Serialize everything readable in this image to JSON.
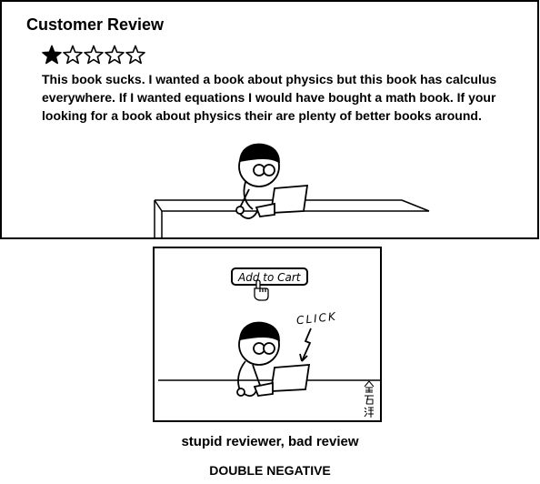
{
  "top_panel": {
    "title": "Customer Review",
    "rating": {
      "filled": 1,
      "max": 5
    },
    "review_text": "This book sucks.  I wanted a book about physics but this book has calculus everywhere.  If I wanted equations I would have bought a math book.  If your looking for a book about physics their are plenty of better books around."
  },
  "bottom_panel": {
    "button_label": "Add to Cart",
    "sound_effect": "CLICK",
    "signature": "金石淬"
  },
  "captions": {
    "subtitle": "stupid reviewer, bad review",
    "title": "DOUBLE NEGATIVE"
  }
}
